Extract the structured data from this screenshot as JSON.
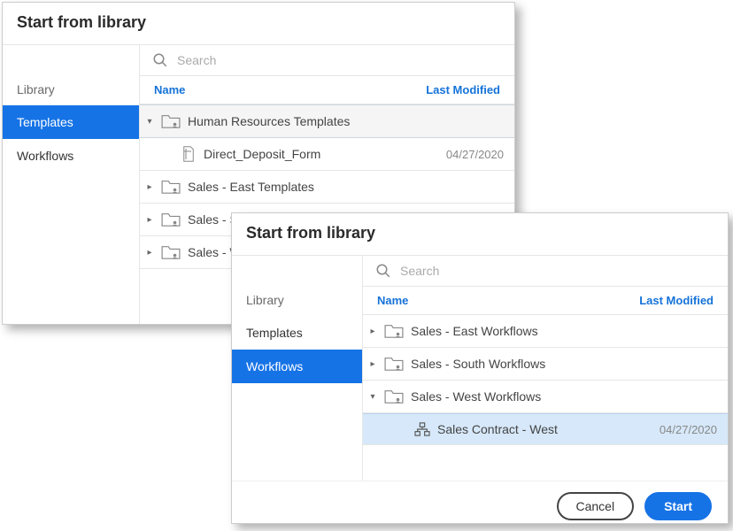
{
  "back": {
    "title": "Start from library",
    "sidebar": {
      "heading": "Library",
      "items": [
        {
          "label": "Templates",
          "selected": true
        },
        {
          "label": "Workflows",
          "selected": false
        }
      ]
    },
    "search_placeholder": "Search",
    "columns": {
      "name": "Name",
      "modified": "Last Modified"
    },
    "rows": [
      {
        "type": "folder",
        "expanded": true,
        "label": "Human Resources Templates"
      },
      {
        "type": "doc",
        "child": true,
        "label": "Direct_Deposit_Form",
        "modified": "04/27/2020"
      },
      {
        "type": "folder",
        "expanded": false,
        "label": "Sales - East Templates"
      },
      {
        "type": "folder",
        "expanded": false,
        "label": "Sales - South Templates",
        "truncated": "Sales - So"
      },
      {
        "type": "folder",
        "expanded": false,
        "label": "Sales - West Templates",
        "truncated": "Sales - W"
      }
    ]
  },
  "front": {
    "title": "Start from library",
    "sidebar": {
      "heading": "Library",
      "items": [
        {
          "label": "Templates",
          "selected": false
        },
        {
          "label": "Workflows",
          "selected": true
        }
      ]
    },
    "search_placeholder": "Search",
    "columns": {
      "name": "Name",
      "modified": "Last Modified"
    },
    "rows": [
      {
        "type": "folder",
        "expanded": false,
        "label": "Sales - East Workflows"
      },
      {
        "type": "folder",
        "expanded": false,
        "label": "Sales - South Workflows"
      },
      {
        "type": "folder",
        "expanded": true,
        "label": "Sales - West Workflows"
      },
      {
        "type": "workflow",
        "child": true,
        "selected": true,
        "label": "Sales Contract - West",
        "modified": "04/27/2020"
      }
    ],
    "buttons": {
      "cancel": "Cancel",
      "start": "Start"
    }
  }
}
